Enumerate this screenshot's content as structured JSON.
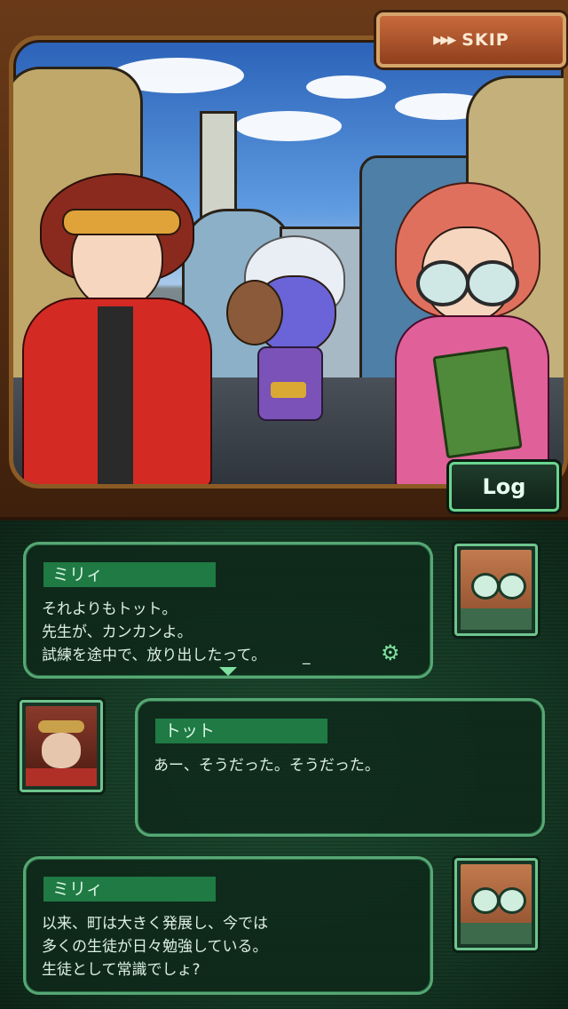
{
  "controls": {
    "skip_label": "SKIP",
    "log_label": "Log"
  },
  "dialog": [
    {
      "speaker": "ミリィ",
      "lines": "それよりもトット。\n先生が、カンカンよ。\n試練を途中で、放り出したって。",
      "cursor": "_"
    },
    {
      "speaker": "トット",
      "lines": "あー、そうだった。そうだった。"
    },
    {
      "speaker": "ミリィ",
      "lines": "以来、町は大きく発展し、今では\n多くの生徒が日々勉強している。\n生徒として常識でしょ?"
    }
  ],
  "icons": {
    "gear": "gear-icon",
    "down_arrow": "chevron-down-icon",
    "skip_arrows": "fast-forward-icon"
  },
  "colors": {
    "panel_bg": "#143522",
    "bubble_border": "#56a874",
    "name_tag": "#1f7a44",
    "skip_button": "#c86a3c",
    "log_border": "#6ad48f"
  }
}
